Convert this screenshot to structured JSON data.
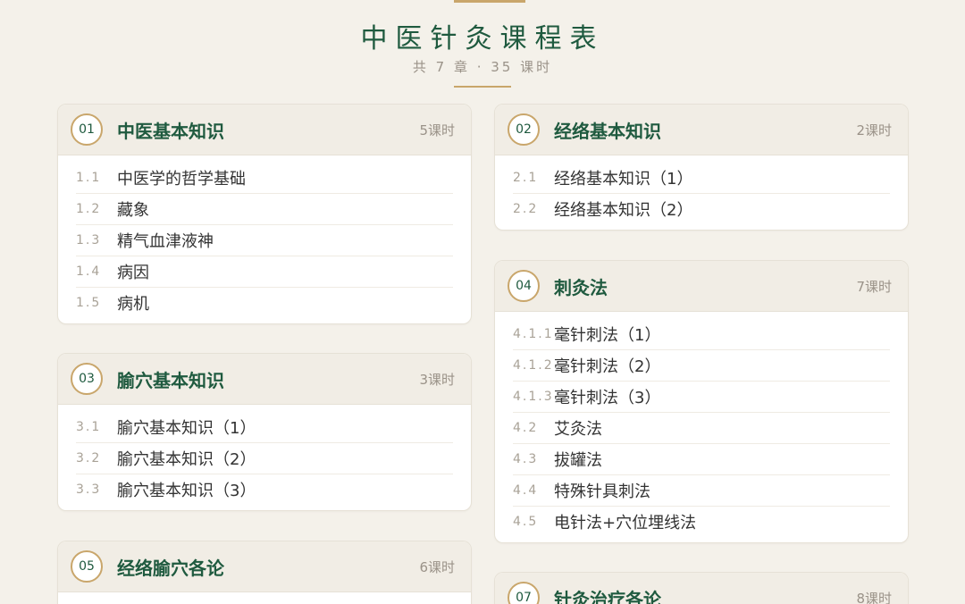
{
  "header": {
    "title": "中医针灸课程表",
    "subtitle": "共 7 章 · 35 课时"
  },
  "chapters": [
    {
      "num": "01",
      "title": "中医基本知识",
      "hours": "5课时",
      "items": [
        {
          "idx": "1.1",
          "label": "中医学的哲学基础"
        },
        {
          "idx": "1.2",
          "label": "藏象"
        },
        {
          "idx": "1.3",
          "label": "精气血津液神"
        },
        {
          "idx": "1.4",
          "label": "病因"
        },
        {
          "idx": "1.5",
          "label": "病机"
        }
      ]
    },
    {
      "num": "02",
      "title": "经络基本知识",
      "hours": "2课时",
      "items": [
        {
          "idx": "2.1",
          "label": "经络基本知识（1）"
        },
        {
          "idx": "2.2",
          "label": "经络基本知识（2）"
        }
      ]
    },
    {
      "num": "03",
      "title": "腧穴基本知识",
      "hours": "3课时",
      "items": [
        {
          "idx": "3.1",
          "label": "腧穴基本知识（1）"
        },
        {
          "idx": "3.2",
          "label": "腧穴基本知识（2）"
        },
        {
          "idx": "3.3",
          "label": "腧穴基本知识（3）"
        }
      ]
    },
    {
      "num": "04",
      "title": "刺灸法",
      "hours": "7课时",
      "items": [
        {
          "idx": "4.1.1",
          "label": "毫针刺法（1）"
        },
        {
          "idx": "4.1.2",
          "label": "毫针刺法（2）"
        },
        {
          "idx": "4.1.3",
          "label": "毫针刺法（3）"
        },
        {
          "idx": "4.2",
          "label": "艾灸法"
        },
        {
          "idx": "4.3",
          "label": "拔罐法"
        },
        {
          "idx": "4.4",
          "label": "特殊针具刺法"
        },
        {
          "idx": "4.5",
          "label": "电针法+穴位埋线法"
        }
      ]
    },
    {
      "num": "05",
      "title": "经络腧穴各论",
      "hours": "6课时",
      "items": []
    },
    {
      "num": "07",
      "title": "针灸治疗各论",
      "hours": "8课时",
      "items": []
    }
  ]
}
